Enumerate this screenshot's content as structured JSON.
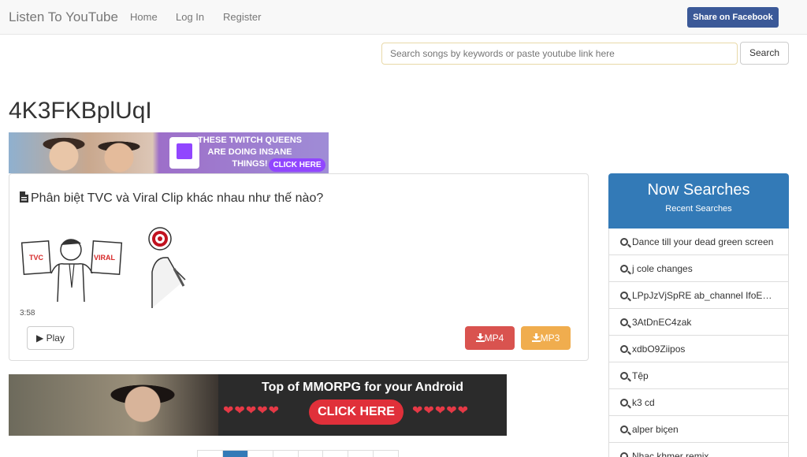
{
  "navbar": {
    "brand": "Listen To YouTube",
    "links": [
      "Home",
      "Log In",
      "Register"
    ],
    "share_label": "Share on Facebook"
  },
  "search": {
    "placeholder": "Search songs by keywords or paste youtube link here",
    "button_label": "Search"
  },
  "page_title": "4K3FKBplUqI",
  "ad_top": {
    "text": "THESE TWITCH QUEENS ARE DOING INSANE THINGS!",
    "cta": "CLICK HERE"
  },
  "video": {
    "title": "Phân biệt TVC và Viral Clip khác nhau như thế nào?",
    "thumb_labels": [
      "TVC",
      "VIRAL"
    ],
    "duration": "3:58",
    "play_label": "Play",
    "mp4_label": "MP4",
    "mp3_label": "MP3"
  },
  "ad_bottom": {
    "headline": "Top of MMORPG for your Android",
    "hearts_left": "❤❤❤❤❤",
    "hearts_right": "❤❤❤❤❤",
    "cta": "CLICK HERE"
  },
  "sidebar": {
    "title": "Now Searches",
    "subtitle": "Recent Searches",
    "items": [
      "Dance till your dead green screen",
      "j cole changes",
      "LPpJzVjSpRE ab_channel IfoE…",
      "3AtDnEC4zak",
      "xdbO9Ziipos",
      "Tệp",
      "k3 cd",
      "alper biçen",
      "Nhạc khmer remix"
    ]
  },
  "colors": {
    "primary": "#337ab7",
    "facebook": "#3b5998",
    "mp4": "#d9534f",
    "mp3": "#f0ad4e"
  }
}
